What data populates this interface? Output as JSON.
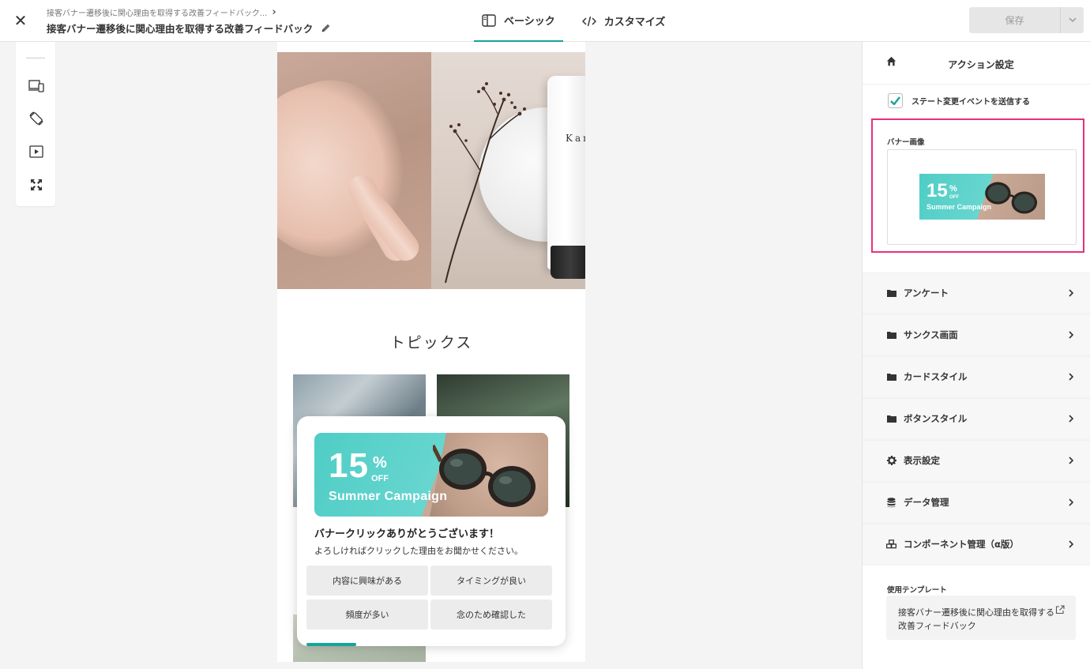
{
  "header": {
    "close_glyph": "✕",
    "breadcrumb": "接客バナー遷移後に関心理由を取得する改善フィードバック...",
    "title": "接客バナー遷移後に関心理由を取得する改善フィードバック",
    "modes": [
      {
        "label": "ベーシック",
        "icon": "sidebar-layout-icon",
        "active": true
      },
      {
        "label": "カスタマイズ",
        "icon": "code-icon",
        "active": false
      }
    ],
    "save_label": "保存"
  },
  "left_toolbar": {
    "tools": [
      "device-preview-icon",
      "rotate-device-icon",
      "play-preview-icon",
      "fullscreen-expand-icon"
    ]
  },
  "preview": {
    "hero_product_text": "Kar",
    "topics_title": "トピックス",
    "popup": {
      "banner": {
        "percent": "15",
        "percent_sign": "%",
        "off": "OFF",
        "campaign": "Summer Campaign"
      },
      "title": "バナークリックありがとうございます！",
      "subtitle": "よろしければクリックした理由をお聞かせください。",
      "choices": [
        "内容に興味がある",
        "タイミングが良い",
        "頻度が多い",
        "念のため確認した"
      ],
      "progress": 0.2
    }
  },
  "right_panel": {
    "title": "アクション設定",
    "checkbox": {
      "label": "ステート変更イベントを送信する",
      "checked": true
    },
    "banner_image_label": "バナー画像",
    "highlight_color": "#e8307a",
    "accent_color": "#17a398",
    "sections": [
      {
        "label": "アンケート",
        "icon": "folder-icon"
      },
      {
        "label": "サンクス画面",
        "icon": "folder-icon"
      },
      {
        "label": "カードスタイル",
        "icon": "folder-icon"
      },
      {
        "label": "ボタンスタイル",
        "icon": "folder-icon"
      },
      {
        "label": "表示設定",
        "icon": "gear-icon"
      },
      {
        "label": "データ管理",
        "icon": "database-icon"
      },
      {
        "label": "コンポーネント管理（α版）",
        "icon": "cubes-icon"
      }
    ],
    "template_label": "使用テンプレート",
    "template_name": "接客バナー遷移後に関心理由を取得する改善フィードバック"
  }
}
